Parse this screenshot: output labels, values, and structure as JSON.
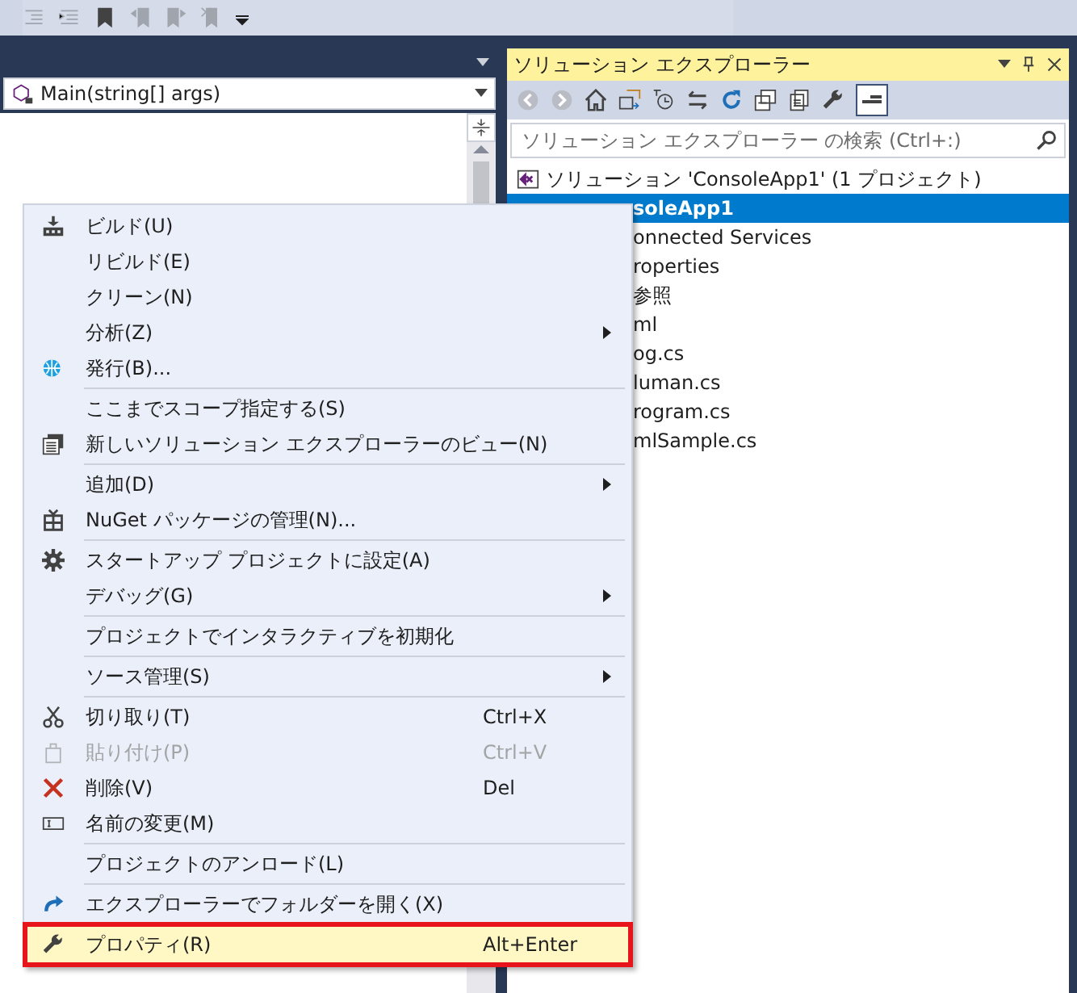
{
  "editor": {
    "member_dropdown": "Main(string[] args)"
  },
  "solution_explorer": {
    "title": "ソリューション エクスプローラー",
    "search": {
      "placeholder": "ソリューション エクスプローラー の検索 (Ctrl+:)"
    },
    "tree": [
      {
        "label": "ソリューション 'ConsoleApp1' (1 プロジェクト)",
        "selected": false,
        "children": [
          {
            "label": "soleApp1",
            "selected": true
          },
          {
            "label": "onnected Services",
            "selected": false
          },
          {
            "label": "roperties",
            "selected": false
          },
          {
            "label": "参照",
            "selected": false
          },
          {
            "label": "ml",
            "selected": false
          },
          {
            "label": "og.cs",
            "selected": false
          },
          {
            "label": "luman.cs",
            "selected": false
          },
          {
            "label": "rogram.cs",
            "selected": false
          },
          {
            "label": "mlSample.cs",
            "selected": false
          }
        ]
      }
    ]
  },
  "context_menu": [
    {
      "kind": "item",
      "label": "ビルド(U)",
      "disabled": false,
      "submenu": false,
      "selected": false
    },
    {
      "kind": "item",
      "label": "リビルド(E)",
      "disabled": false,
      "submenu": false,
      "selected": false
    },
    {
      "kind": "item",
      "label": "クリーン(N)",
      "disabled": false,
      "submenu": false,
      "selected": false
    },
    {
      "kind": "item",
      "label": "分析(Z)",
      "disabled": false,
      "submenu": true,
      "selected": false
    },
    {
      "kind": "item",
      "label": "発行(B)...",
      "disabled": false,
      "submenu": false,
      "selected": false
    },
    {
      "kind": "separator"
    },
    {
      "kind": "item",
      "label": "ここまでスコープ指定する(S)",
      "disabled": false,
      "submenu": false,
      "selected": false
    },
    {
      "kind": "item",
      "label": "新しいソリューション エクスプローラーのビュー(N)",
      "disabled": false,
      "submenu": false,
      "selected": false
    },
    {
      "kind": "separator"
    },
    {
      "kind": "item",
      "label": "追加(D)",
      "disabled": false,
      "submenu": true,
      "selected": false
    },
    {
      "kind": "item",
      "label": "NuGet パッケージの管理(N)...",
      "disabled": false,
      "submenu": false,
      "selected": false
    },
    {
      "kind": "separator"
    },
    {
      "kind": "item",
      "label": "スタートアップ プロジェクトに設定(A)",
      "disabled": false,
      "submenu": false,
      "selected": false
    },
    {
      "kind": "item",
      "label": "デバッグ(G)",
      "disabled": false,
      "submenu": true,
      "selected": false
    },
    {
      "kind": "separator"
    },
    {
      "kind": "item",
      "label": "プロジェクトでインタラクティブを初期化",
      "disabled": false,
      "submenu": false,
      "selected": false
    },
    {
      "kind": "separator"
    },
    {
      "kind": "item",
      "label": "ソース管理(S)",
      "disabled": false,
      "submenu": true,
      "selected": false
    },
    {
      "kind": "separator"
    },
    {
      "kind": "item",
      "label": "切り取り(T)",
      "shortcut": "Ctrl+X",
      "disabled": false,
      "submenu": false,
      "selected": false
    },
    {
      "kind": "item",
      "label": "貼り付け(P)",
      "shortcut": "Ctrl+V",
      "disabled": true,
      "submenu": false,
      "selected": false
    },
    {
      "kind": "item",
      "label": "削除(V)",
      "shortcut": "Del",
      "disabled": false,
      "submenu": false,
      "selected": false
    },
    {
      "kind": "item",
      "label": "名前の変更(M)",
      "disabled": false,
      "submenu": false,
      "selected": false
    },
    {
      "kind": "separator"
    },
    {
      "kind": "item",
      "label": "プロジェクトのアンロード(L)",
      "disabled": false,
      "submenu": false,
      "selected": false
    },
    {
      "kind": "separator"
    },
    {
      "kind": "item",
      "label": "エクスプローラーでフォルダーを開く(X)",
      "disabled": false,
      "submenu": false,
      "selected": false
    },
    {
      "kind": "separator"
    },
    {
      "kind": "item",
      "label": "プロパティ(R)",
      "shortcut": "Alt+Enter",
      "disabled": false,
      "submenu": false,
      "selected": true
    }
  ]
}
